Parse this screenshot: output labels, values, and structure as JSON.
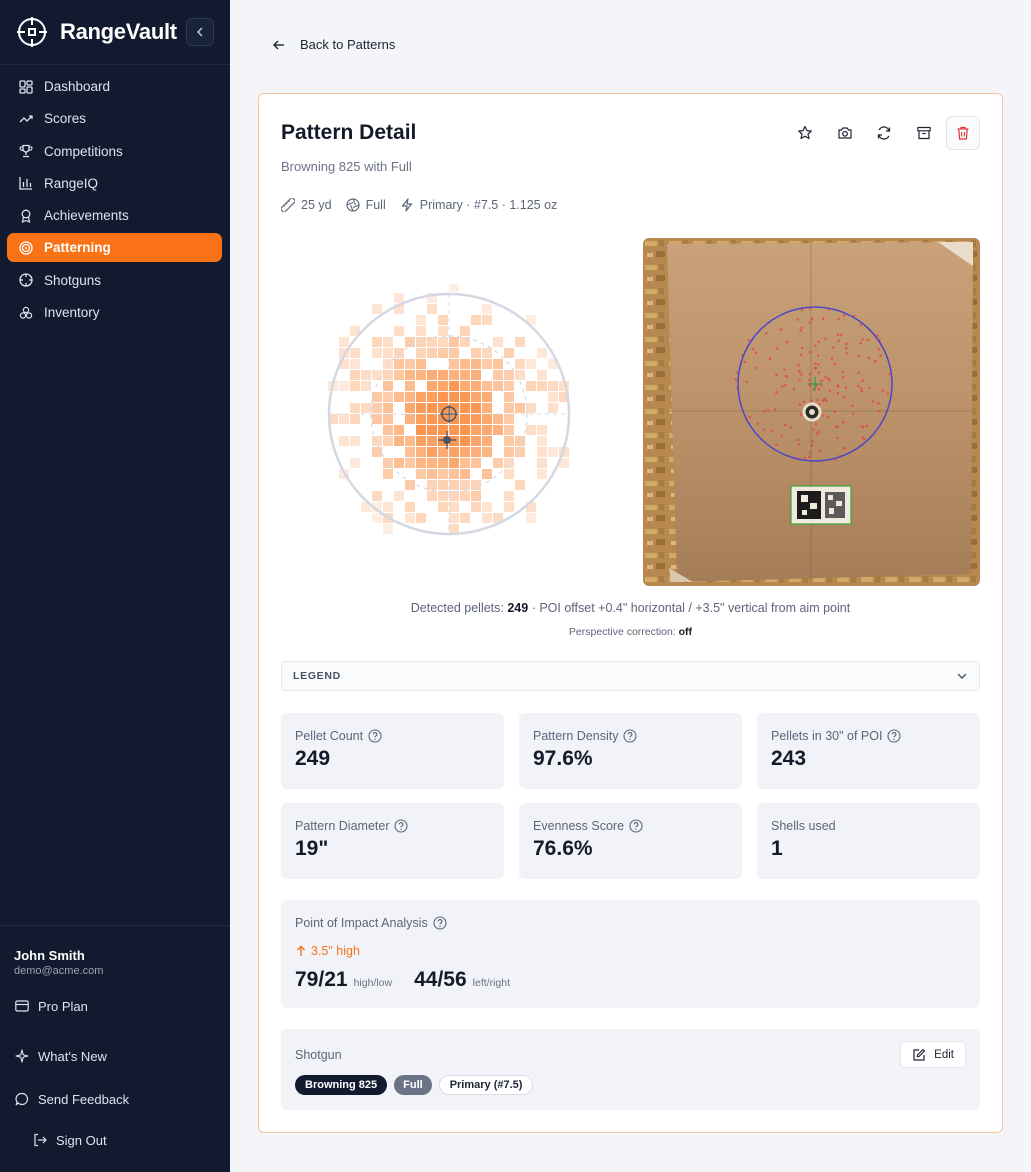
{
  "app": {
    "name": "RangeVault"
  },
  "sidebar": {
    "nav": [
      {
        "label": "Dashboard",
        "icon": "grid-icon"
      },
      {
        "label": "Scores",
        "icon": "trend-icon"
      },
      {
        "label": "Competitions",
        "icon": "trophy-icon"
      },
      {
        "label": "RangeIQ",
        "icon": "bar-chart-icon"
      },
      {
        "label": "Achievements",
        "icon": "award-icon"
      },
      {
        "label": "Patterning",
        "icon": "target-icon",
        "active": true
      },
      {
        "label": "Shotguns",
        "icon": "crosshair-icon"
      },
      {
        "label": "Inventory",
        "icon": "boxes-icon"
      }
    ],
    "user": {
      "name": "John Smith",
      "email": "demo@acme.com"
    },
    "plan_label": "Pro Plan",
    "whats_new_label": "What's New",
    "feedback_label": "Send Feedback",
    "signout_label": "Sign Out"
  },
  "back_label": "Back to Patterns",
  "pattern": {
    "title": "Pattern Detail",
    "subtitle": "Browning 825 with Full",
    "distance": "25 yd",
    "choke": "Full",
    "load": "Primary · #7.5 · 1.125 oz"
  },
  "detection": {
    "prefix": "Detected pellets: ",
    "count": "249",
    "suffix": " · POI offset +0.4\" horizontal / +3.5\" vertical from aim point",
    "perspective_prefix": "Perspective correction: ",
    "perspective_value": "off"
  },
  "legend_label": "LEGEND",
  "stats": [
    {
      "label": "Pellet Count",
      "value": "249",
      "help": true
    },
    {
      "label": "Pattern Density",
      "value": "97.6%",
      "help": true
    },
    {
      "label": "Pellets in 30\" of POI",
      "value": "243",
      "help": true
    },
    {
      "label": "Pattern Diameter",
      "value": "19\"",
      "help": true
    },
    {
      "label": "Evenness Score",
      "value": "76.6%",
      "help": true
    },
    {
      "label": "Shells used",
      "value": "1",
      "help": false
    }
  ],
  "poi": {
    "title": "Point of Impact Analysis",
    "direction": "3.5\" high",
    "high_low_value": "79/21",
    "high_low_label": "high/low",
    "left_right_value": "44/56",
    "left_right_label": "left/right"
  },
  "shotgun": {
    "title": "Shotgun",
    "edit_label": "Edit",
    "chips": [
      "Browning 825",
      "Full",
      "Primary (#7.5)"
    ]
  },
  "colors": {
    "accent": "#f97316",
    "sidebar_bg": "#111a2e",
    "danger": "#e0343a",
    "heat": "#f97316"
  }
}
